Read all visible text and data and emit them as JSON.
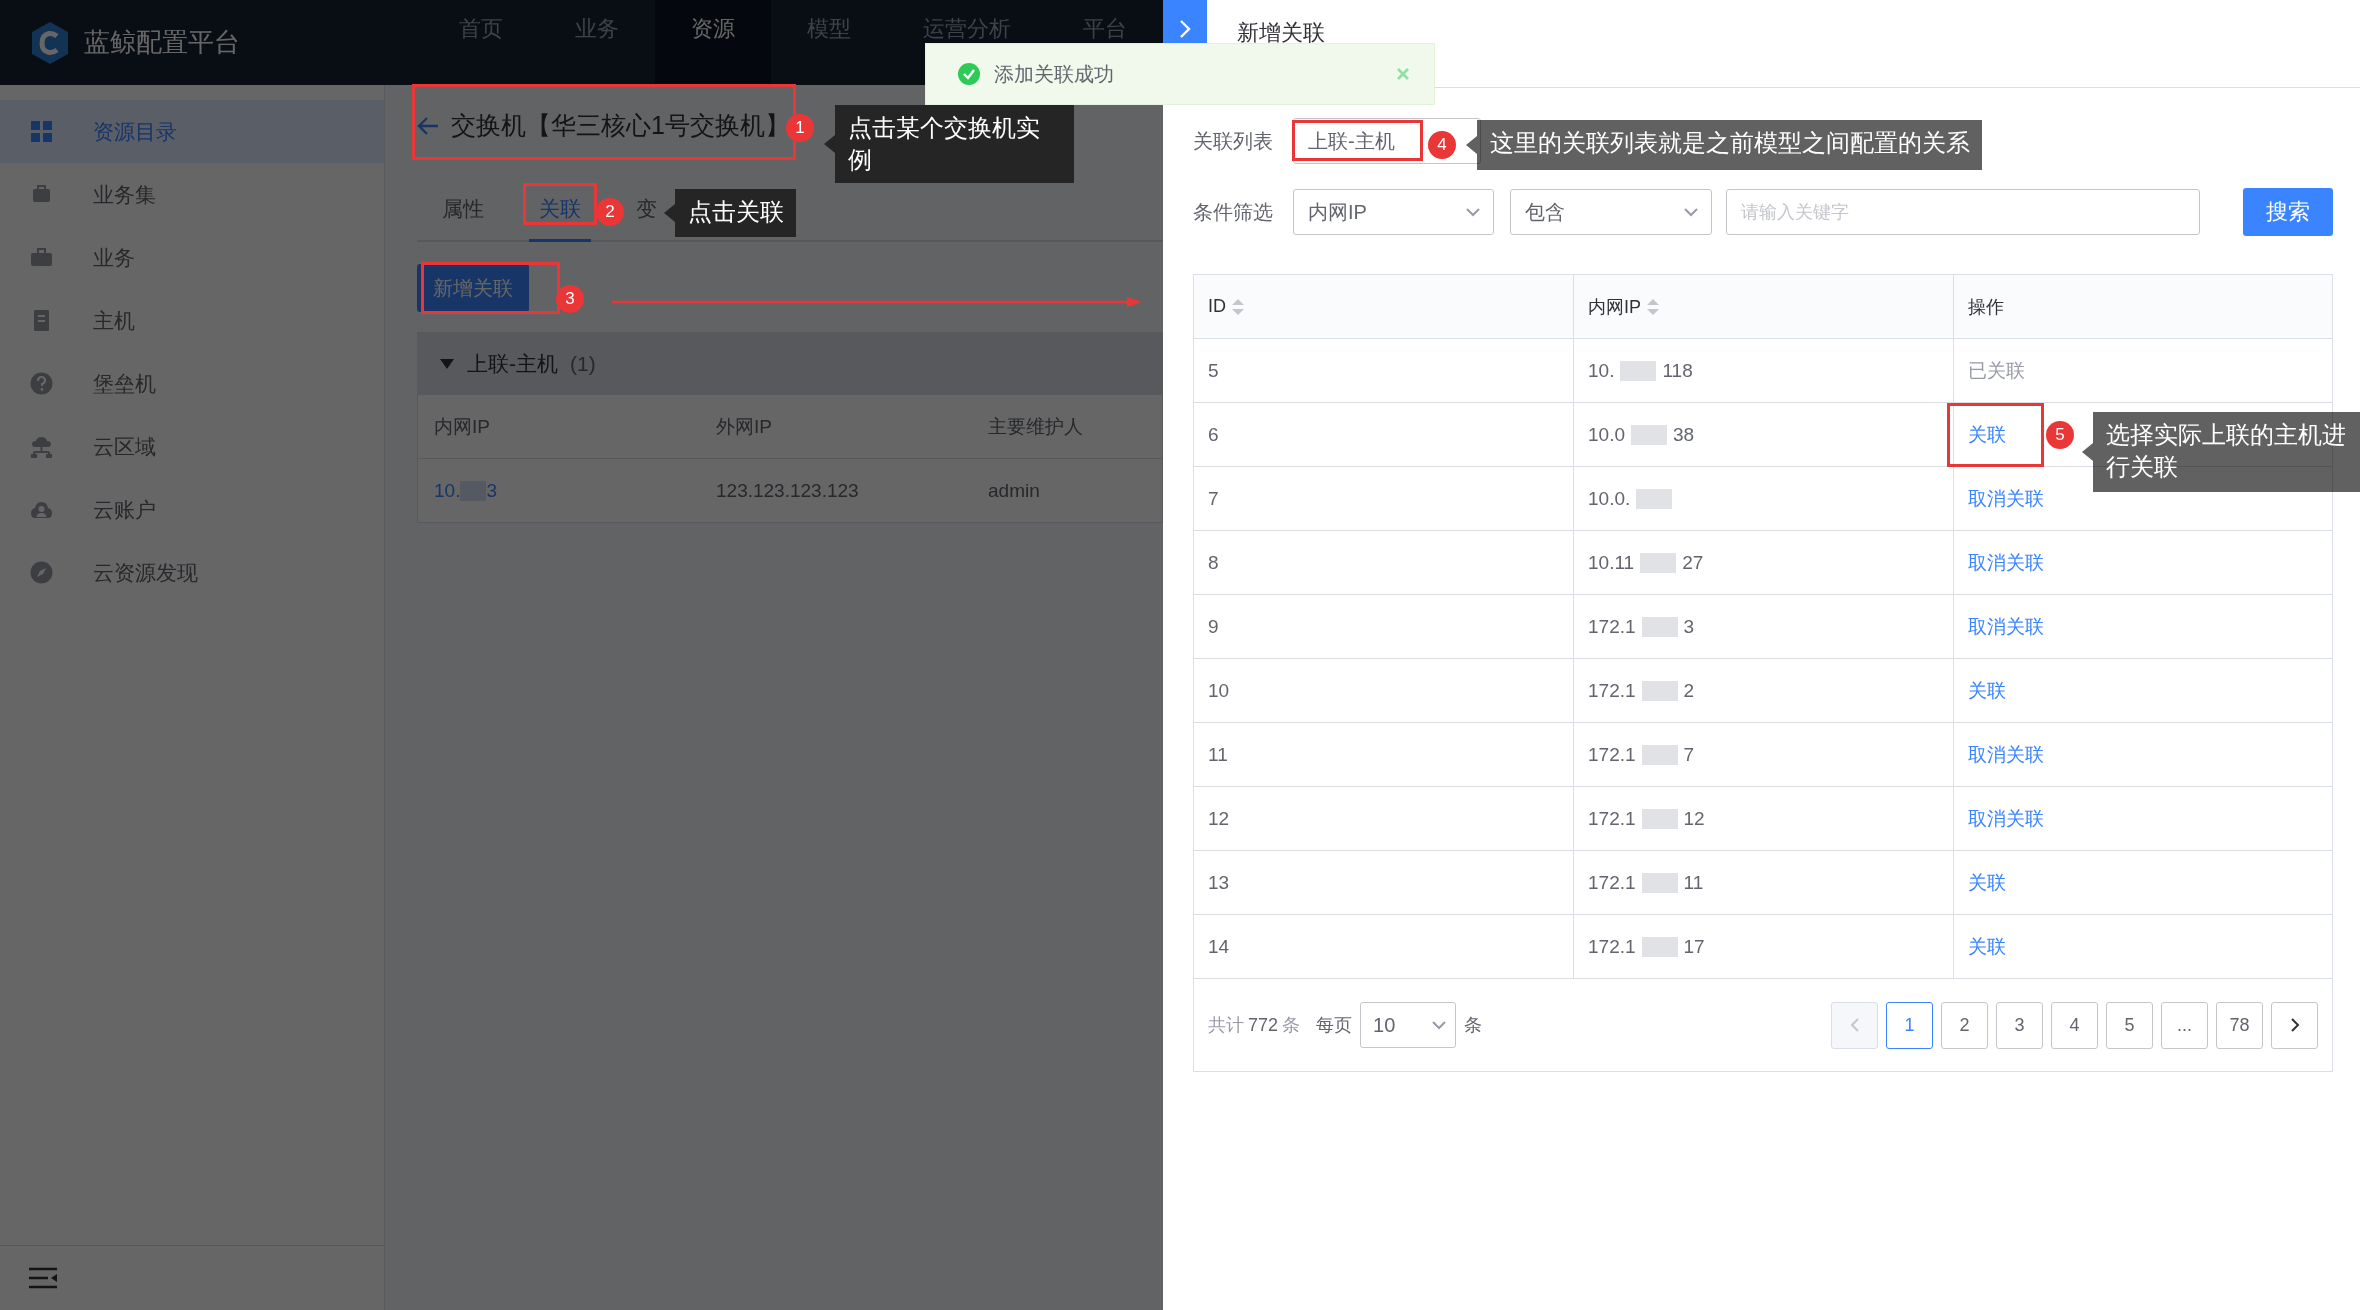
{
  "header": {
    "logo_text": "蓝鲸配置平台",
    "nav": [
      {
        "label": "首页",
        "selected": false
      },
      {
        "label": "业务",
        "selected": false
      },
      {
        "label": "资源",
        "selected": true
      },
      {
        "label": "模型",
        "selected": false
      },
      {
        "label": "运营分析",
        "selected": false
      },
      {
        "label": "平台",
        "selected": false
      }
    ]
  },
  "sidebar": {
    "items": [
      {
        "label": "资源目录",
        "selected": true
      },
      {
        "label": "业务集",
        "selected": false
      },
      {
        "label": "业务",
        "selected": false
      },
      {
        "label": "主机",
        "selected": false
      },
      {
        "label": "堡垒机",
        "selected": false
      },
      {
        "label": "云区域",
        "selected": false
      },
      {
        "label": "云账户",
        "selected": false
      },
      {
        "label": "云资源发现",
        "selected": false
      }
    ]
  },
  "detail": {
    "title": "交换机【华三核心1号交换机】",
    "tabs": [
      {
        "label": "属性",
        "selected": false
      },
      {
        "label": "关联",
        "selected": true
      },
      {
        "label": "变",
        "selected": false
      }
    ],
    "add_button": "新增关联",
    "group": {
      "title": "上联-主机",
      "count": "(1)",
      "expanded": true,
      "columns": [
        "内网IP",
        "外网IP",
        "主要维护人"
      ],
      "rows": [
        {
          "ip_start": "10.",
          "ip_end": "3",
          "outer_ip": "123.123.123.123",
          "maintainer": "admin"
        }
      ]
    }
  },
  "drawer": {
    "title": "新增关联",
    "relation_label": "关联列表",
    "relation_value": "上联-主机",
    "filter_label": "条件筛选",
    "filter_field": "内网IP",
    "filter_operator": "包含",
    "search_placeholder": "请输入关键字",
    "search_button": "搜索",
    "table": {
      "columns": [
        {
          "label": "ID",
          "sortable": true
        },
        {
          "label": "内网IP",
          "sortable": true
        },
        {
          "label": "操作",
          "sortable": false
        }
      ],
      "rows": [
        {
          "id": "5",
          "ip_start": "10.",
          "ip_end": "118",
          "action": "已关联",
          "kind": "linked"
        },
        {
          "id": "6",
          "ip_start": "10.0",
          "ip_end": "38",
          "action": "关联",
          "kind": "link"
        },
        {
          "id": "7",
          "ip_start": "10.0.",
          "action": "取消关联",
          "kind": "unlink"
        },
        {
          "id": "8",
          "ip_start": "10.11",
          "ip_end": "27",
          "action": "取消关联",
          "kind": "unlink"
        },
        {
          "id": "9",
          "ip_start": "172.1",
          "ip_end": "3",
          "action": "取消关联",
          "kind": "unlink"
        },
        {
          "id": "10",
          "ip_start": "172.1",
          "ip_end": "2",
          "action": "关联",
          "kind": "link"
        },
        {
          "id": "11",
          "ip_start": "172.1",
          "ip_end": "7",
          "action": "取消关联",
          "kind": "unlink"
        },
        {
          "id": "12",
          "ip_start": "172.1",
          "ip_end": "12",
          "action": "取消关联",
          "kind": "unlink"
        },
        {
          "id": "13",
          "ip_start": "172.1",
          "ip_end": "11",
          "action": "关联",
          "kind": "link"
        },
        {
          "id": "14",
          "ip_start": "172.1",
          "ip_end": "17",
          "action": "关联",
          "kind": "link"
        }
      ]
    },
    "pagination": {
      "total_prefix": "共计",
      "total": "772",
      "total_suffix": "条",
      "per_page_label": "每页",
      "per_page": "10",
      "per_page_suffix": "条",
      "prev_disabled": true,
      "pages": [
        {
          "label": "1",
          "selected": true
        },
        {
          "label": "2",
          "selected": false
        },
        {
          "label": "3",
          "selected": false
        },
        {
          "label": "4",
          "selected": false
        },
        {
          "label": "5",
          "selected": false
        },
        {
          "label": "...",
          "selected": false
        },
        {
          "label": "78",
          "selected": false
        }
      ]
    }
  },
  "toast": {
    "message": "添加关联成功"
  },
  "annotations": [
    {
      "number": "1",
      "text": "点击某个交换机实例"
    },
    {
      "number": "2",
      "text": "点击关联"
    },
    {
      "number": "3"
    },
    {
      "number": "4",
      "text": "这里的关联列表就是之前模型之间配置的关系"
    },
    {
      "number": "5",
      "text": "选择实际上联的主机进行关联"
    }
  ]
}
